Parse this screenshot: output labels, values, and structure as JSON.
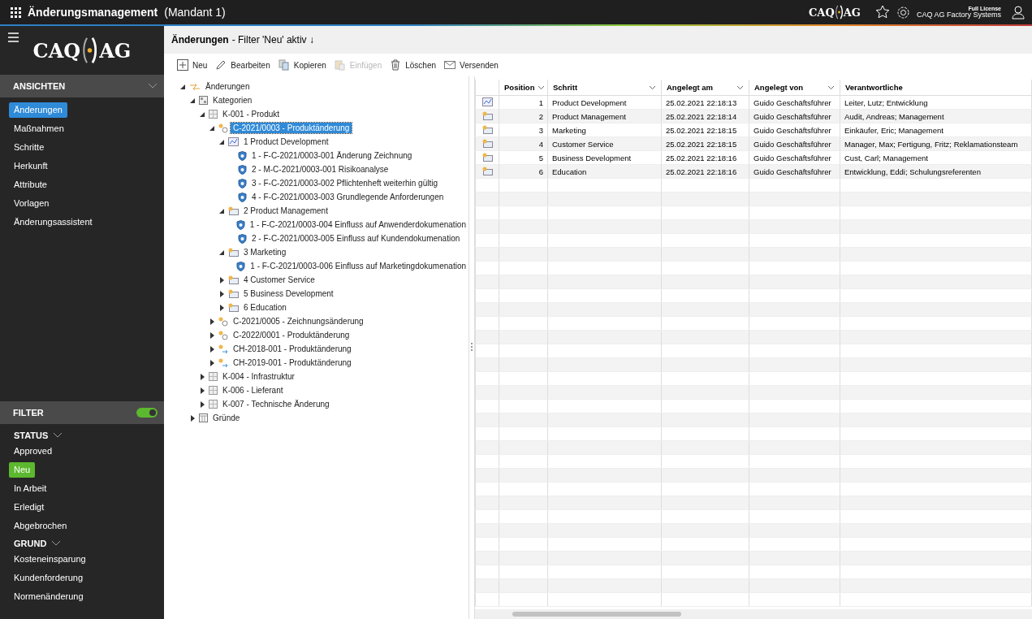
{
  "app_bar": {
    "title": "Änderungsmanagement",
    "subtitle": "(Mandant 1)",
    "logo": {
      "left": "CAQ",
      "right": "AG"
    },
    "license": "Full License",
    "company": "CAQ AG Factory Systems"
  },
  "sidebar": {
    "logo": {
      "left": "CAQ",
      "right": "AG"
    },
    "views": {
      "title": "ANSICHTEN",
      "expanded": true,
      "items": [
        {
          "label": "Änderungen",
          "selected": true
        },
        {
          "label": "Maßnahmen",
          "selected": false
        },
        {
          "label": "Schritte",
          "selected": false
        },
        {
          "label": "Herkunft",
          "selected": false
        },
        {
          "label": "Attribute",
          "selected": false
        },
        {
          "label": "Vorlagen",
          "selected": false
        },
        {
          "label": "Änderungsassistent",
          "selected": false
        }
      ]
    },
    "filter": {
      "title": "FILTER",
      "on": true,
      "groups": [
        {
          "title": "STATUS",
          "items": [
            {
              "label": "Approved",
              "selected": false
            },
            {
              "label": "Neu",
              "selected": true
            },
            {
              "label": "In Arbeit",
              "selected": false
            },
            {
              "label": "Erledigt",
              "selected": false
            },
            {
              "label": "Abgebrochen",
              "selected": false
            }
          ]
        },
        {
          "title": "GRUND",
          "items": [
            {
              "label": "Kosteneinsparung",
              "selected": false
            },
            {
              "label": "Kundenforderung",
              "selected": false
            },
            {
              "label": "Normenänderung",
              "selected": false
            }
          ]
        }
      ]
    }
  },
  "header": {
    "title": "Änderungen",
    "filter_note": "- Filter 'Neu' aktiv ↓"
  },
  "toolbar": [
    {
      "kind": "plus",
      "label": "Neu",
      "disabled": false
    },
    {
      "kind": "pencil",
      "label": "Bearbeiten",
      "disabled": false
    },
    {
      "kind": "copy",
      "label": "Kopieren",
      "disabled": false
    },
    {
      "kind": "paste",
      "label": "Einfügen",
      "disabled": true
    },
    {
      "kind": "trash",
      "label": "Löschen",
      "disabled": false
    },
    {
      "kind": "mail",
      "label": "Versenden",
      "disabled": false
    }
  ],
  "tree": [
    {
      "kind": "flow",
      "label": "Änderungen",
      "expanded": true,
      "selected": false,
      "children": [
        {
          "kind": "categories",
          "label": "Kategorien",
          "expanded": true,
          "selected": false,
          "children": [
            {
              "kind": "category",
              "label": "K-001 - Produkt",
              "expanded": true,
              "selected": false,
              "children": [
                {
                  "kind": "change",
                  "label": "C-2021/0003 - Produktänderung",
                  "expanded": true,
                  "selected": true,
                  "children": [
                    {
                      "kind": "step-active",
                      "label": "1 Product Development",
                      "expanded": true,
                      "selected": false,
                      "children": [
                        {
                          "kind": "measure",
                          "label": "1 - F-C-2021/0003-001 Änderung Zeichnung",
                          "selected": false
                        },
                        {
                          "kind": "measure",
                          "label": "2 - M-C-2021/0003-001 Risikoanalyse",
                          "selected": false
                        },
                        {
                          "kind": "measure",
                          "label": "3 - F-C-2021/0003-002 Pflichtenheft weiterhin gültig",
                          "selected": false
                        },
                        {
                          "kind": "measure",
                          "label": "4 - F-C-2021/0003-003 Grundlegende Anforderungen",
                          "selected": false
                        }
                      ]
                    },
                    {
                      "kind": "step",
                      "label": "2 Product Management",
                      "expanded": true,
                      "selected": false,
                      "children": [
                        {
                          "kind": "measure",
                          "label": "1 - F-C-2021/0003-004 Einfluss auf Anwenderdokumenation",
                          "selected": false
                        },
                        {
                          "kind": "measure",
                          "label": "2 - F-C-2021/0003-005 Einfluss auf Kundendokumenation",
                          "selected": false
                        }
                      ]
                    },
                    {
                      "kind": "step",
                      "label": "3 Marketing",
                      "expanded": true,
                      "selected": false,
                      "children": [
                        {
                          "kind": "measure",
                          "label": "1 - F-C-2021/0003-006 Einfluss auf Marketingdokumenation",
                          "selected": false
                        }
                      ]
                    },
                    {
                      "kind": "step",
                      "label": "4 Customer Service",
                      "expanded": false,
                      "selected": false
                    },
                    {
                      "kind": "step",
                      "label": "5 Business Development",
                      "expanded": false,
                      "selected": false
                    },
                    {
                      "kind": "step",
                      "label": "6 Education",
                      "expanded": false,
                      "selected": false
                    }
                  ]
                },
                {
                  "kind": "change",
                  "label": "C-2021/0005 - Zeichnungsänderung",
                  "expanded": false,
                  "selected": false
                },
                {
                  "kind": "change",
                  "label": "C-2022/0001 - Produktänderung",
                  "expanded": false,
                  "selected": false
                },
                {
                  "kind": "change-flow",
                  "label": "CH-2018-001 - Produktänderung",
                  "expanded": false,
                  "selected": false
                },
                {
                  "kind": "change-flow",
                  "label": "CH-2019-001 - Produktänderung",
                  "expanded": false,
                  "selected": false
                }
              ]
            },
            {
              "kind": "category",
              "label": "K-004 - Infrastruktur",
              "expanded": false,
              "selected": false
            },
            {
              "kind": "category",
              "label": "K-006 - Lieferant",
              "expanded": false,
              "selected": false
            },
            {
              "kind": "category",
              "label": "K-007 - Technische Änderung",
              "expanded": false,
              "selected": false
            }
          ]
        },
        {
          "kind": "table",
          "label": "Gründe",
          "expanded": false,
          "selected": false
        }
      ]
    }
  ],
  "grid": {
    "columns": [
      {
        "label": "Position",
        "filter": true
      },
      {
        "label": "Schritt",
        "filter": true
      },
      {
        "label": "Angelegt am",
        "filter": true
      },
      {
        "label": "Angelegt von",
        "filter": true
      },
      {
        "label": "Verantwortliche",
        "filter": false
      }
    ],
    "rows": [
      {
        "kind": "step-active",
        "cells": [
          "1",
          "Product Development",
          "25.02.2021 22:18:13",
          "Guido Geschäftsführer",
          "Leiter, Lutz; Entwicklung"
        ]
      },
      {
        "kind": "step",
        "cells": [
          "2",
          "Product Management",
          "25.02.2021 22:18:14",
          "Guido Geschäftsführer",
          "Audit, Andreas; Management"
        ]
      },
      {
        "kind": "step",
        "cells": [
          "3",
          "Marketing",
          "25.02.2021 22:18:15",
          "Guido Geschäftsführer",
          "Einkäufer, Eric; Management"
        ]
      },
      {
        "kind": "step",
        "cells": [
          "4",
          "Customer Service",
          "25.02.2021 22:18:15",
          "Guido Geschäftsführer",
          "Manager, Max; Fertigung, Fritz; Reklamationsteam"
        ]
      },
      {
        "kind": "step",
        "cells": [
          "5",
          "Business Development",
          "25.02.2021 22:18:16",
          "Guido Geschäftsführer",
          "Cust, Carl; Management"
        ]
      },
      {
        "kind": "step",
        "cells": [
          "6",
          "Education",
          "25.02.2021 22:18:16",
          "Guido Geschäftsführer",
          "Entwicklung, Eddi; Schulungsreferenten"
        ]
      }
    ]
  }
}
